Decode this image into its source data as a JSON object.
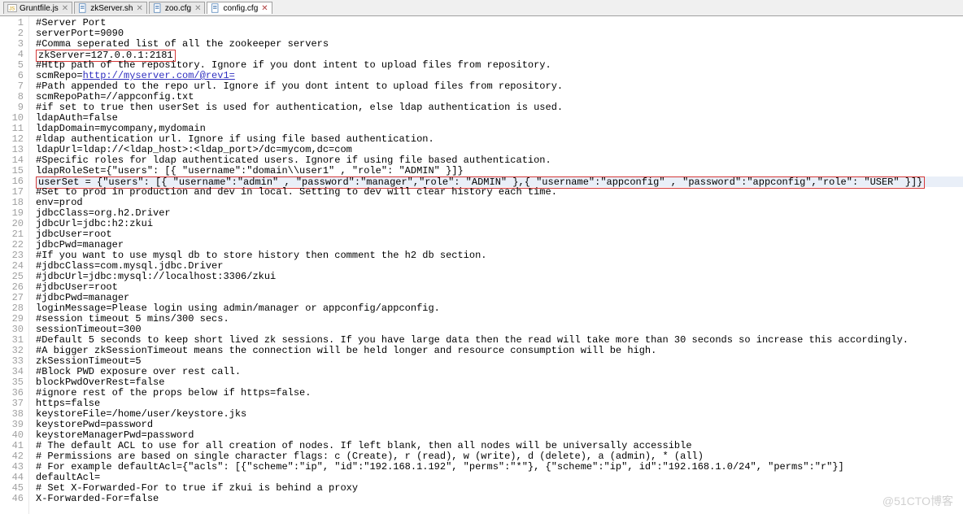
{
  "tabs": [
    {
      "icon": "js",
      "label": "Gruntfile.js",
      "close": "✕",
      "dirty": false
    },
    {
      "icon": "file",
      "label": "zkServer.sh",
      "close": "✕",
      "dirty": false
    },
    {
      "icon": "file",
      "label": "zoo.cfg",
      "close": "✕",
      "dirty": false
    },
    {
      "icon": "file",
      "label": "config.cfg",
      "close": "✕",
      "dirty": true,
      "active": true
    }
  ],
  "lines": [
    {
      "n": 1,
      "t": "#Server Port"
    },
    {
      "n": 2,
      "t": "serverPort=9090"
    },
    {
      "n": 3,
      "t": "#Comma seperated list of all the zookeeper servers"
    },
    {
      "n": 4,
      "boxed": true,
      "t": "zkServer=127.0.0.1:2181"
    },
    {
      "n": 5,
      "t": "#Http path of the repository. Ignore if you dont intent to upload files from repository."
    },
    {
      "n": 6,
      "pre": "scmRepo=",
      "link": "http://myserver.com/@rev1="
    },
    {
      "n": 7,
      "t": "#Path appended to the repo url. Ignore if you dont intent to upload files from repository."
    },
    {
      "n": 8,
      "t": "scmRepoPath=//appconfig.txt"
    },
    {
      "n": 9,
      "t": "#if set to true then userSet is used for authentication, else ldap authentication is used."
    },
    {
      "n": 10,
      "t": "ldapAuth=false"
    },
    {
      "n": 11,
      "t": "ldapDomain=mycompany,mydomain"
    },
    {
      "n": 12,
      "t": "#ldap authentication url. Ignore if using file based authentication."
    },
    {
      "n": 13,
      "t": "ldapUrl=ldap://<ldap_host>:<ldap_port>/dc=mycom,dc=com"
    },
    {
      "n": 14,
      "t": "#Specific roles for ldap authenticated users. Ignore if using file based authentication."
    },
    {
      "n": 15,
      "t": "ldapRoleSet={\"users\": [{ \"username\":\"domain\\\\user1\" , \"role\": \"ADMIN\" }]}"
    },
    {
      "n": 16,
      "hl": true,
      "boxed": true,
      "t": "userSet = {\"users\": [{ \"username\":\"admin\" , \"password\":\"manager\",\"role\": \"ADMIN\" },{ \"username\":\"appconfig\" , \"password\":\"appconfig\",\"role\": \"USER\" }]}"
    },
    {
      "n": 17,
      "t": "#Set to prod in production and dev in local. Setting to dev will clear history each time."
    },
    {
      "n": 18,
      "t": "env=prod"
    },
    {
      "n": 19,
      "t": "jdbcClass=org.h2.Driver"
    },
    {
      "n": 20,
      "t": "jdbcUrl=jdbc:h2:zkui"
    },
    {
      "n": 21,
      "t": "jdbcUser=root"
    },
    {
      "n": 22,
      "t": "jdbcPwd=manager"
    },
    {
      "n": 23,
      "t": "#If you want to use mysql db to store history then comment the h2 db section."
    },
    {
      "n": 24,
      "t": "#jdbcClass=com.mysql.jdbc.Driver"
    },
    {
      "n": 25,
      "t": "#jdbcUrl=jdbc:mysql://localhost:3306/zkui"
    },
    {
      "n": 26,
      "t": "#jdbcUser=root"
    },
    {
      "n": 27,
      "t": "#jdbcPwd=manager"
    },
    {
      "n": 28,
      "t": "loginMessage=Please login using admin/manager or appconfig/appconfig."
    },
    {
      "n": 29,
      "t": "#session timeout 5 mins/300 secs."
    },
    {
      "n": 30,
      "t": "sessionTimeout=300"
    },
    {
      "n": 31,
      "t": "#Default 5 seconds to keep short lived zk sessions. If you have large data then the read will take more than 30 seconds so increase this accordingly."
    },
    {
      "n": 32,
      "t": "#A bigger zkSessionTimeout means the connection will be held longer and resource consumption will be high."
    },
    {
      "n": 33,
      "t": "zkSessionTimeout=5"
    },
    {
      "n": 34,
      "t": "#Block PWD exposure over rest call."
    },
    {
      "n": 35,
      "t": "blockPwdOverRest=false"
    },
    {
      "n": 36,
      "t": "#ignore rest of the props below if https=false."
    },
    {
      "n": 37,
      "t": "https=false"
    },
    {
      "n": 38,
      "t": "keystoreFile=/home/user/keystore.jks"
    },
    {
      "n": 39,
      "t": "keystorePwd=password"
    },
    {
      "n": 40,
      "t": "keystoreManagerPwd=password"
    },
    {
      "n": 41,
      "t": "# The default ACL to use for all creation of nodes. If left blank, then all nodes will be universally accessible"
    },
    {
      "n": 42,
      "t": "# Permissions are based on single character flags: c (Create), r (read), w (write), d (delete), a (admin), * (all)"
    },
    {
      "n": 43,
      "t": "# For example defaultAcl={\"acls\": [{\"scheme\":\"ip\", \"id\":\"192.168.1.192\", \"perms\":\"*\"}, {\"scheme\":\"ip\", id\":\"192.168.1.0/24\", \"perms\":\"r\"}]"
    },
    {
      "n": 44,
      "t": "defaultAcl="
    },
    {
      "n": 45,
      "t": "# Set X-Forwarded-For to true if zkui is behind a proxy"
    },
    {
      "n": 46,
      "t": "X-Forwarded-For=false"
    }
  ],
  "watermark": "@51CTO博客"
}
